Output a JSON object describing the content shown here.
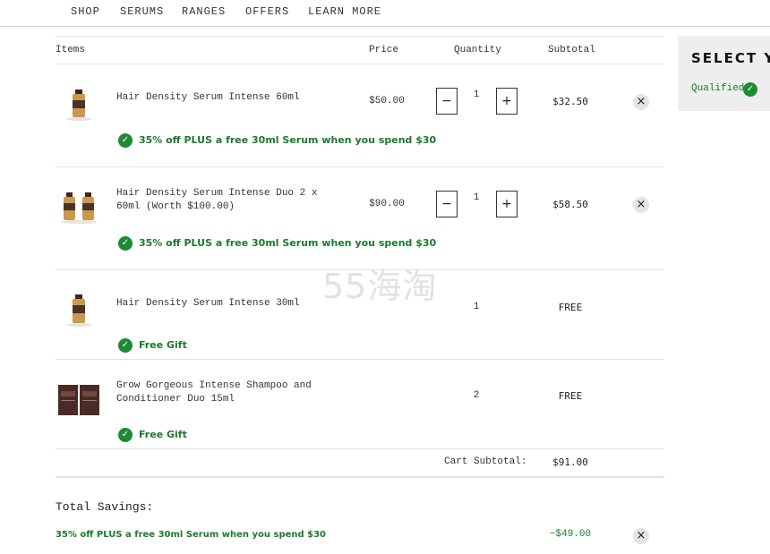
{
  "nav": {
    "items": [
      "SHOP",
      "SERUMS",
      "RANGES",
      "OFFERS",
      "LEARN MORE"
    ]
  },
  "cart": {
    "headers": {
      "items": "Items",
      "price": "Price",
      "quantity": "Quantity",
      "subtotal": "Subtotal"
    },
    "rows": [
      {
        "name": "Hair Density Serum Intense 60ml",
        "price": "$50.00",
        "quantity": "1",
        "subtotal": "$32.50",
        "promo": "35% off PLUS a free 30ml Serum when you spend $30",
        "thumb_icon": "serum-bottle-icon"
      },
      {
        "name": "Hair Density Serum Intense Duo 2 x 60ml (Worth $100.00)",
        "price": "$90.00",
        "quantity": "1",
        "subtotal": "$58.50",
        "promo": "35% off PLUS a free 30ml Serum when you spend $30",
        "thumb_icon": "serum-duo-icon"
      },
      {
        "name": "Hair Density Serum Intense 30ml",
        "quantity": "1",
        "subtotal": "FREE",
        "promo": "Free Gift",
        "thumb_icon": "serum-bottle-icon"
      },
      {
        "name": "Grow Gorgeous Intense Shampoo and Conditioner Duo 15ml",
        "quantity": "2",
        "subtotal": "FREE",
        "promo": "Free Gift",
        "thumb_icon": "sachet-icon"
      }
    ],
    "minus_glyph": "−",
    "plus_glyph": "+",
    "remove_glyph": "×",
    "check_glyph": "✓",
    "cart_subtotal_label": "Cart Subtotal:",
    "cart_subtotal_value": "$91.00"
  },
  "savings": {
    "title": "Total Savings:",
    "promo": "35% off PLUS a free 30ml Serum when you spend $30",
    "value": "−$49.00"
  },
  "select_panel": {
    "title": "SELECT Y",
    "qualified": "Qualified"
  },
  "watermark": "55海淘",
  "colors": {
    "promo_green": "#1c7a2c",
    "check_green": "#1e8a34",
    "panel_gray": "#eeeeee"
  }
}
